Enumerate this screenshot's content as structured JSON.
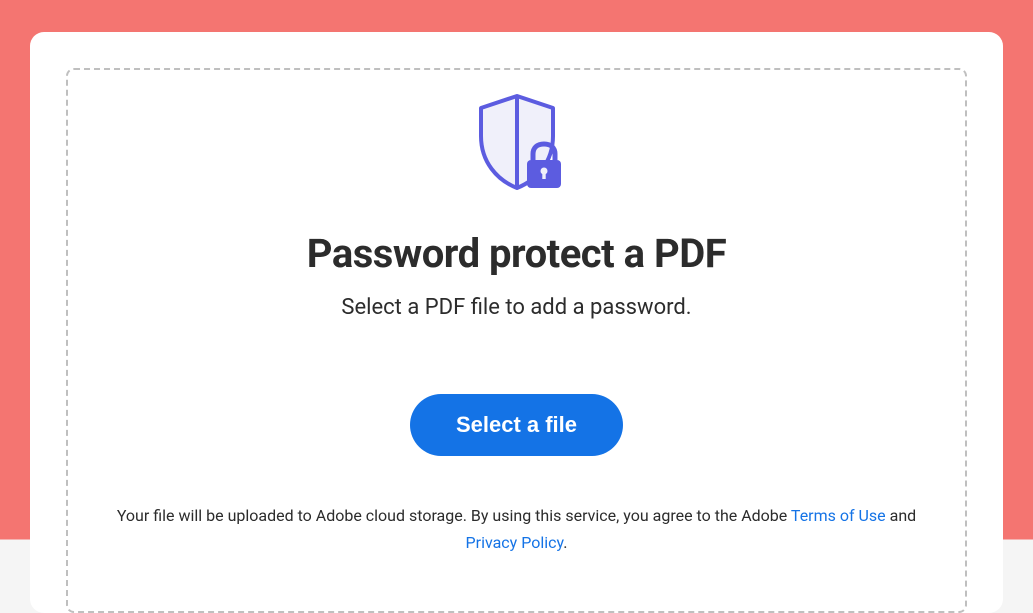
{
  "hero": {
    "title": "Password protect a PDF",
    "subtitle": "Select a PDF file to add a password.",
    "button_label": "Select a file"
  },
  "legal": {
    "prefix": "Your file will be uploaded to Adobe cloud storage.  By using this service, you agree to the Adobe ",
    "terms_label": "Terms of Use",
    "and": " and ",
    "privacy_label": "Privacy Policy",
    "suffix": "."
  }
}
